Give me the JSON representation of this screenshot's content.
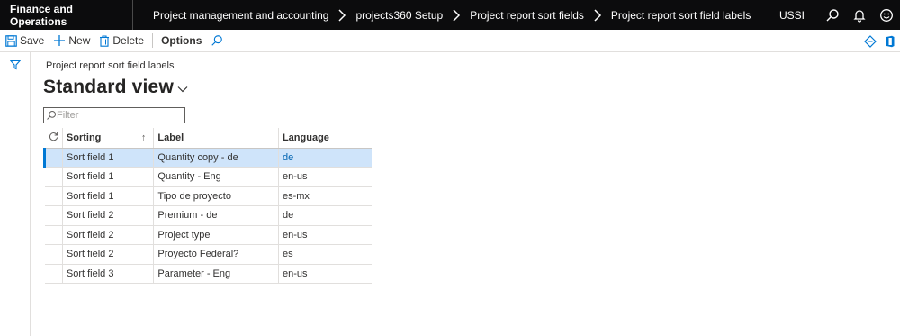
{
  "topbar": {
    "app_name": "Finance and Operations",
    "breadcrumbs": [
      "Project management and accounting",
      "projects360 Setup",
      "Project report sort fields",
      "Project report sort field labels"
    ],
    "company": "USSI",
    "icons": [
      "search-icon",
      "bell-icon",
      "smiley-icon"
    ]
  },
  "actionpane": {
    "save_label": "Save",
    "new_label": "New",
    "delete_label": "Delete",
    "options_label": "Options",
    "right_icons": [
      "diamond-icon",
      "office-icon"
    ]
  },
  "page": {
    "caption": "Project report sort field labels",
    "view_title": "Standard view"
  },
  "filter": {
    "placeholder": "Filter",
    "value": ""
  },
  "grid": {
    "columns": [
      "Sorting",
      "Label",
      "Language"
    ],
    "sort_indicator": "↑",
    "rows": [
      {
        "sorting": "Sort field 1",
        "label": "Quantity copy - de",
        "language": "de",
        "selected": true
      },
      {
        "sorting": "Sort field 1",
        "label": "Quantity - Eng",
        "language": "en-us",
        "selected": false
      },
      {
        "sorting": "Sort field 1",
        "label": "Tipo de proyecto",
        "language": "es-mx",
        "selected": false
      },
      {
        "sorting": "Sort field 2",
        "label": "Premium - de",
        "language": "de",
        "selected": false
      },
      {
        "sorting": "Sort field 2",
        "label": "Project type",
        "language": "en-us",
        "selected": false
      },
      {
        "sorting": "Sort field 2",
        "label": "Proyecto Federal?",
        "language": "es",
        "selected": false
      },
      {
        "sorting": "Sort field 3",
        "label": "Parameter - Eng",
        "language": "en-us",
        "selected": false
      }
    ]
  },
  "colors": {
    "topbar_bg": "#0c0c0d",
    "accent": "#0078d4",
    "selected_row": "#cfe4fa"
  }
}
